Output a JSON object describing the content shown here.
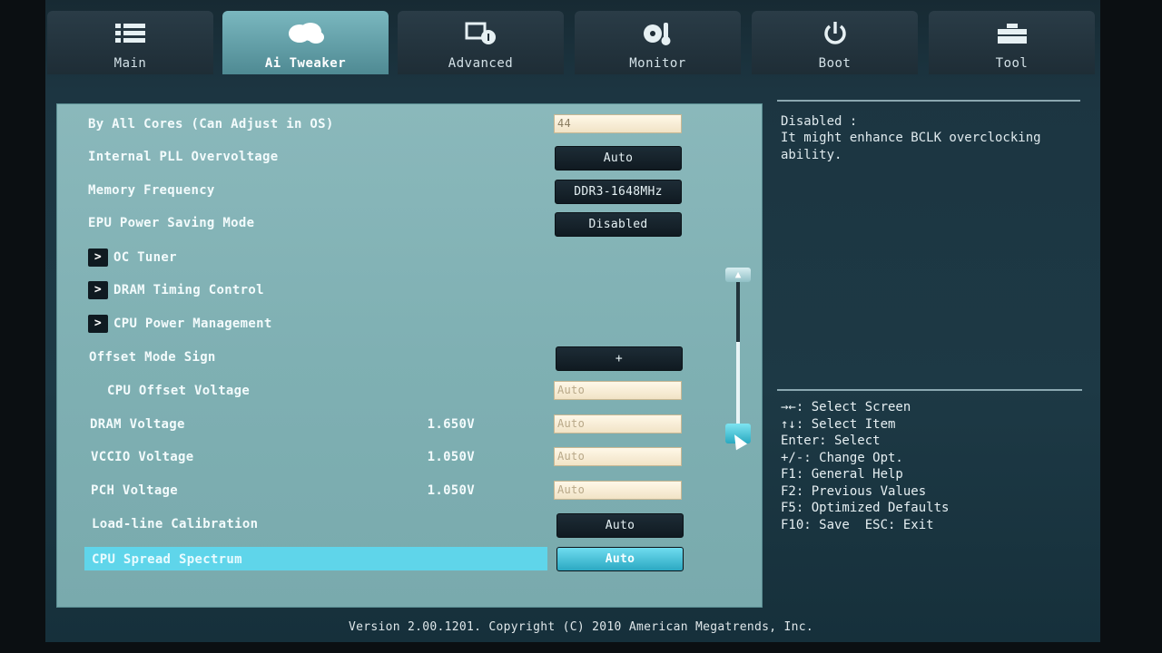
{
  "tabs": [
    {
      "label": "Main",
      "icon": "list-icon"
    },
    {
      "label": "Ai Tweaker",
      "icon": "cloud-icon"
    },
    {
      "label": "Advanced",
      "icon": "advanced-settings-icon"
    },
    {
      "label": "Monitor",
      "icon": "thermometer-fan-icon"
    },
    {
      "label": "Boot",
      "icon": "power-icon"
    },
    {
      "label": "Tool",
      "icon": "toolbox-icon"
    }
  ],
  "active_tab": "Ai Tweaker",
  "settings": [
    {
      "label": "By All Cores (Can Adjust in OS)",
      "control": "field",
      "value": "44"
    },
    {
      "label": "Internal PLL Overvoltage",
      "control": "button",
      "value": "Auto"
    },
    {
      "label": "Memory Frequency",
      "control": "button",
      "value": "DDR3-1648MHz"
    },
    {
      "label": "EPU Power Saving Mode",
      "control": "button",
      "value": "Disabled"
    },
    {
      "label": "OC Tuner",
      "control": "submenu"
    },
    {
      "label": "DRAM Timing Control",
      "control": "submenu"
    },
    {
      "label": "CPU Power Management",
      "control": "submenu"
    },
    {
      "label": "Offset Mode Sign",
      "control": "button",
      "value": "+"
    },
    {
      "label": "CPU Offset Voltage",
      "control": "field",
      "value": "Auto"
    },
    {
      "label": "DRAM Voltage",
      "control": "field",
      "value": "Auto",
      "reading": "1.650V"
    },
    {
      "label": "VCCIO Voltage",
      "control": "field",
      "value": "Auto",
      "reading": "1.050V"
    },
    {
      "label": "PCH Voltage",
      "control": "field",
      "value": "Auto",
      "reading": "1.050V"
    },
    {
      "label": "Load-line Calibration",
      "control": "button",
      "value": "Auto"
    },
    {
      "label": "CPU Spread Spectrum",
      "control": "button",
      "value": "Auto",
      "selected": true
    }
  ],
  "help": {
    "title": "Disabled :",
    "line1": "It might enhance BCLK overclocking",
    "line2": "ability."
  },
  "keys": [
    "→←: Select Screen",
    "↑↓: Select Item",
    "Enter: Select",
    "+/-: Change Opt.",
    "F1: General Help",
    "F2: Previous Values",
    "F5: Optimized Defaults",
    "F10: Save  ESC: Exit"
  ],
  "footer": "Version 2.00.1201. Copyright (C) 2010 American Megatrends, Inc.",
  "colors": {
    "panel": "#82b3b6",
    "highlight": "#5fd5ea",
    "button": "#101a21",
    "field": "#f7edd6"
  }
}
